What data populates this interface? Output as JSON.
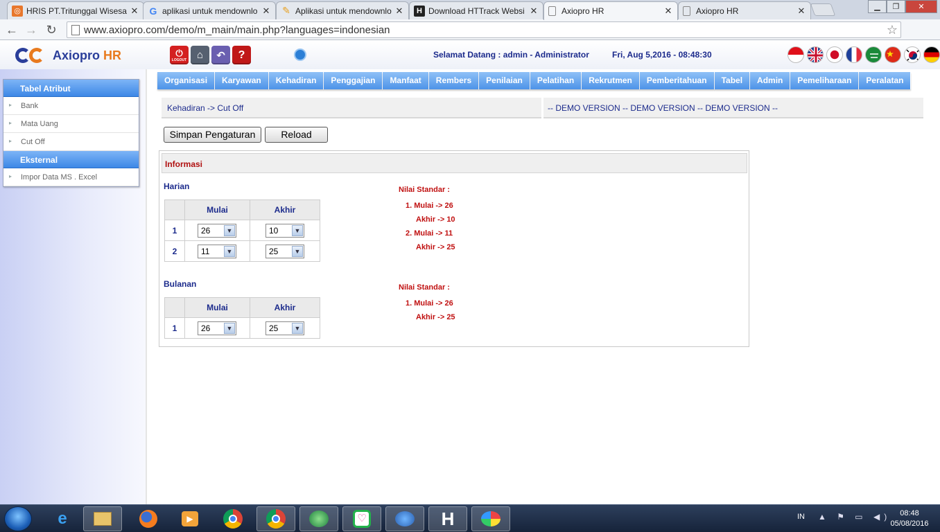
{
  "browser": {
    "tabs": [
      {
        "label": "HRIS PT.Tritunggal Wisesa",
        "icon": "hris-favicon-icon",
        "icon_color": "#e8772c",
        "active": false
      },
      {
        "label": "aplikasi untuk mendownlo",
        "icon": "google-favicon-icon",
        "icon_color": "#4285f4",
        "active": false
      },
      {
        "label": "Aplikasi untuk mendownlo",
        "icon": "pencil-favicon-icon",
        "icon_color": "#e8a020",
        "active": false
      },
      {
        "label": "Download HTTrack Websi",
        "icon": "httrack-favicon-icon",
        "icon_color": "#222222",
        "active": false
      },
      {
        "label": "Axiopro HR",
        "icon": "page-favicon-icon",
        "icon_color": "#888888",
        "active": true
      },
      {
        "label": "Axiopro HR",
        "icon": "page-favicon-icon",
        "icon_color": "#888888",
        "active": false
      }
    ],
    "url": "www.axiopro.com/demo/m_main/main.php?languages=indonesian"
  },
  "header": {
    "logo_main": "Axiopro ",
    "logo_accent": "HR",
    "logout_label": "LOGOUT",
    "welcome": "Selamat Datang : admin - Administrator",
    "datetime": "Fri, Aug 5,2016 - 08:48:30",
    "flags": [
      "indonesia",
      "united-kingdom",
      "japan",
      "france",
      "saudi-arabia",
      "china",
      "korea",
      "germany"
    ]
  },
  "sidebar": {
    "sections": [
      {
        "title": "Tabel Atribut",
        "items": [
          "Bank",
          "Mata Uang",
          "Cut Off"
        ]
      },
      {
        "title": "Eksternal",
        "items": [
          "Impor Data MS . Excel"
        ]
      }
    ]
  },
  "menu": [
    "Organisasi",
    "Karyawan",
    "Kehadiran",
    "Penggajian",
    "Manfaat",
    "Rembers",
    "Penilaian",
    "Pelatihan",
    "Rekrutmen",
    "Pemberitahuan",
    "Tabel",
    "Admin",
    "Pemeliharaan",
    "Peralatan"
  ],
  "breadcrumb": "Kehadiran -> Cut Off",
  "demo_banner": "-- DEMO VERSION -- DEMO VERSION -- DEMO VERSION --",
  "buttons": {
    "save": "Simpan Pengaturan",
    "reload": "Reload"
  },
  "info": {
    "title": "Informasi",
    "harian": {
      "label": "Harian",
      "col_start": "Mulai",
      "col_end": "Akhir",
      "rows": [
        {
          "no": "1",
          "start": "26",
          "end": "10"
        },
        {
          "no": "2",
          "start": "11",
          "end": "25"
        }
      ],
      "std_title": "Nilai Standar :",
      "std_lines": [
        "1. Mulai -> 26",
        "Akhir -> 10",
        "2. Mulai -> 11",
        "Akhir -> 25"
      ]
    },
    "bulanan": {
      "label": "Bulanan",
      "col_start": "Mulai",
      "col_end": "Akhir",
      "rows": [
        {
          "no": "1",
          "start": "26",
          "end": "25"
        }
      ],
      "std_title": "Nilai Standar :",
      "std_lines": [
        "1. Mulai -> 26",
        "Akhir -> 25"
      ]
    }
  },
  "taskbar": {
    "apps": [
      "internet-explorer-icon",
      "file-explorer-icon",
      "firefox-icon",
      "media-player-icon",
      "chrome-icon",
      "chrome-icon",
      "winamp-icon",
      "chat-app-icon",
      "network-app-icon",
      "httrack-icon",
      "paint-icon"
    ],
    "language": "IN",
    "time": "08:48",
    "date": "05/08/2016"
  }
}
